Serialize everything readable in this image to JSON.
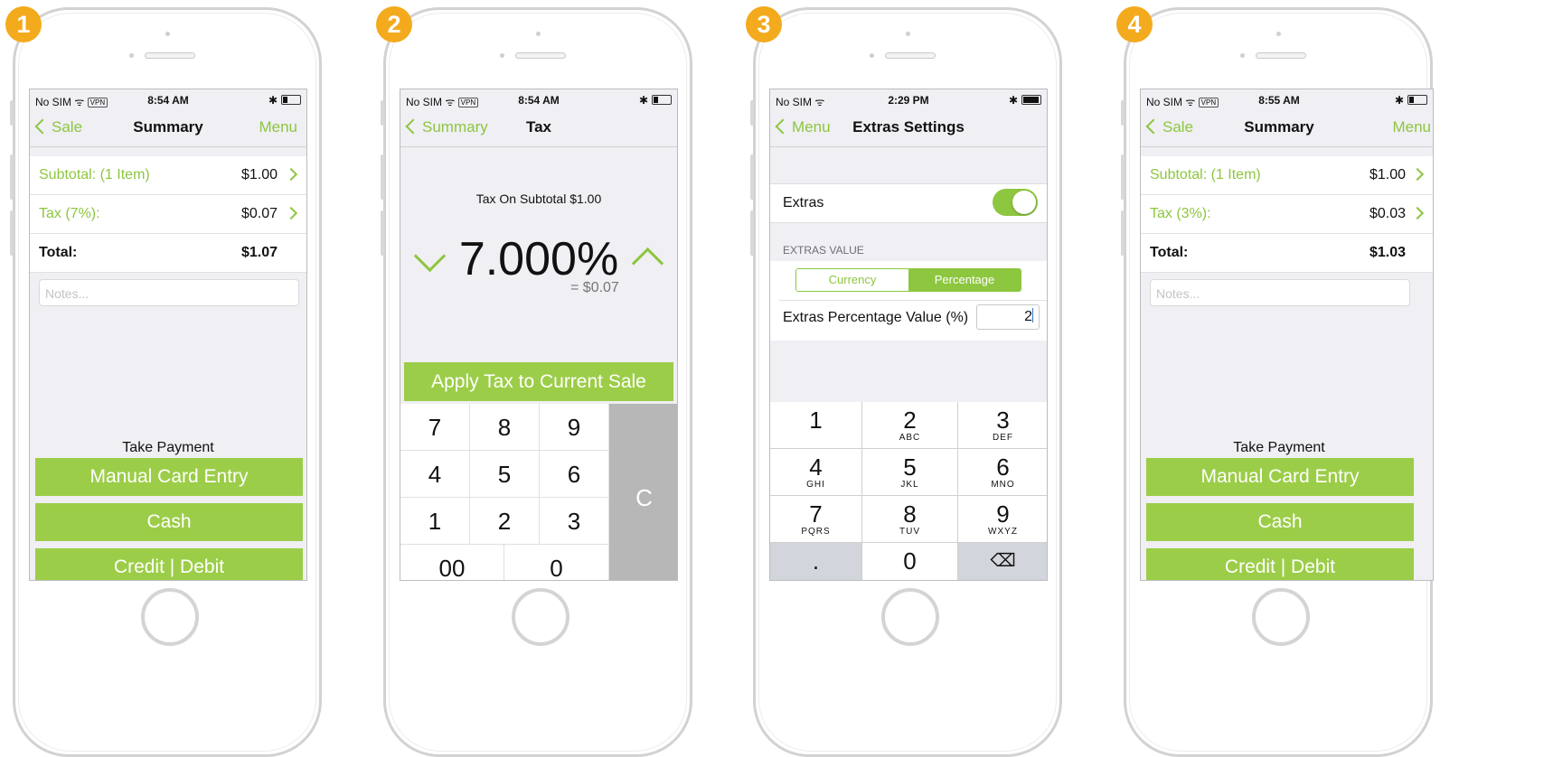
{
  "colors": {
    "accent": "#8dc63f",
    "button": "#9ccd48",
    "badge": "#f3aa1d",
    "clear_key": "#b7b7b7"
  },
  "phones": [
    {
      "badge": "1",
      "status": {
        "carrier": "No SIM",
        "vpn": "VPN",
        "time": "8:54 AM"
      },
      "nav": {
        "back": "Sale",
        "title": "Summary",
        "right": "Menu"
      },
      "rows": [
        {
          "label": "Subtotal: (1 Item)",
          "value": "$1.00"
        },
        {
          "label": "Tax (7%):",
          "value": "$0.07"
        },
        {
          "label": "Total:",
          "value": "$1.07"
        }
      ],
      "notes_placeholder": "Notes...",
      "take_payment": "Take Payment",
      "buttons": [
        "Manual Card Entry",
        "Cash",
        "Credit | Debit"
      ]
    },
    {
      "badge": "2",
      "status": {
        "carrier": "No SIM",
        "vpn": "VPN",
        "time": "8:54 AM"
      },
      "nav": {
        "back": "Summary",
        "title": "Tax"
      },
      "tax_on": "Tax On Subtotal $1.00",
      "percent": "7.000%",
      "equals": "= $0.07",
      "apply_button": "Apply Tax to Current Sale",
      "keys": {
        "k7": "7",
        "k8": "8",
        "k9": "9",
        "k4": "4",
        "k5": "5",
        "k6": "6",
        "k1": "1",
        "k2": "2",
        "k3": "3",
        "k00": "00",
        "k0": "0",
        "clear": "C"
      }
    },
    {
      "badge": "3",
      "status": {
        "carrier": "No SIM",
        "time": "2:29 PM"
      },
      "nav": {
        "back": "Menu",
        "title": "Extras Settings"
      },
      "extras_label": "Extras",
      "extras_on": true,
      "section_header": "EXTRAS VALUE",
      "segments": [
        "Currency",
        "Percentage"
      ],
      "selected_segment": "Percentage",
      "percentage_label": "Extras Percentage Value (%)",
      "percentage_value": "2",
      "keyboard": [
        {
          "n": "1",
          "s": ""
        },
        {
          "n": "2",
          "s": "ABC"
        },
        {
          "n": "3",
          "s": "DEF"
        },
        {
          "n": "4",
          "s": "GHI"
        },
        {
          "n": "5",
          "s": "JKL"
        },
        {
          "n": "6",
          "s": "MNO"
        },
        {
          "n": "7",
          "s": "PQRS"
        },
        {
          "n": "8",
          "s": "TUV"
        },
        {
          "n": "9",
          "s": "WXYZ"
        },
        {
          "n": ".",
          "s": ""
        },
        {
          "n": "0",
          "s": ""
        },
        {
          "n": "⌫",
          "s": ""
        }
      ]
    },
    {
      "badge": "4",
      "status": {
        "carrier": "No SIM",
        "vpn": "VPN",
        "time": "8:55 AM"
      },
      "nav": {
        "back": "Sale",
        "title": "Summary",
        "right": "Menu"
      },
      "rows": [
        {
          "label": "Subtotal: (1 Item)",
          "value": "$1.00"
        },
        {
          "label": "Tax (3%):",
          "value": "$0.03"
        },
        {
          "label": "Total:",
          "value": "$1.03"
        }
      ],
      "notes_placeholder": "Notes...",
      "take_payment": "Take Payment",
      "buttons": [
        "Manual Card Entry",
        "Cash",
        "Credit | Debit"
      ]
    }
  ]
}
